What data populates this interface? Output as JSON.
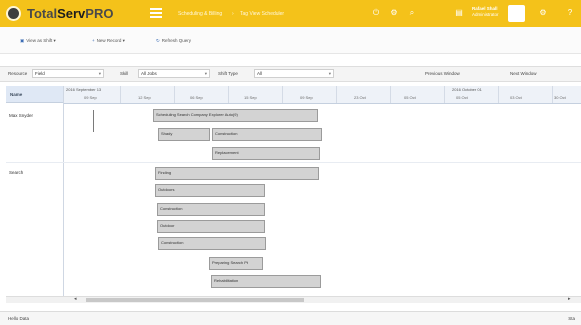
{
  "app": {
    "logo_text_part1": "Total",
    "logo_text_part2": "Serv",
    "logo_text_part3": "PRO",
    "crumbs": [
      "Scheduling & Billing",
      "Tag View Scheduler"
    ],
    "user_name": "Rafael Shall",
    "user_role": "Administrator",
    "brand_color": "#f4c21a"
  },
  "toolbar": {
    "view_as": "View as Shift",
    "new_record": "New Record",
    "refresh": "Refresh Query"
  },
  "filters": {
    "resource_label": "Resource",
    "resource_value": "Field",
    "skill_label": "Skill",
    "skill_value": "All Jobs",
    "status_label": "Shift Type",
    "status_value": "All",
    "prev_btn": "Previous Window",
    "next_btn": "Next Window"
  },
  "scheduler": {
    "resource_header": "Name",
    "months": [
      "2016 September 13",
      "2016 October 01"
    ],
    "days": [
      "09 Sep",
      "12 Sep",
      "06 Sep",
      "15 Sep",
      "09 Sep",
      "23 Oct",
      "05 Oct",
      "05 Oct",
      "03 Oct",
      "30 Oct"
    ],
    "resources": [
      "Max Snyder",
      "Search"
    ],
    "events": [
      {
        "label": "Scheduling Search Company Explorer Auto(9)"
      },
      {
        "label": "Shady"
      },
      {
        "label": "Construction"
      },
      {
        "label": "Replacement"
      },
      {
        "label": "Finding"
      },
      {
        "label": "Outdoors"
      },
      {
        "label": "Construction"
      },
      {
        "label": "Outdoor"
      },
      {
        "label": "Construction"
      },
      {
        "label": "Preparing Search Pt"
      },
      {
        "label": "Rehabilitation"
      }
    ]
  },
  "status": {
    "left": "Hello Data",
    "right": "Sta"
  }
}
